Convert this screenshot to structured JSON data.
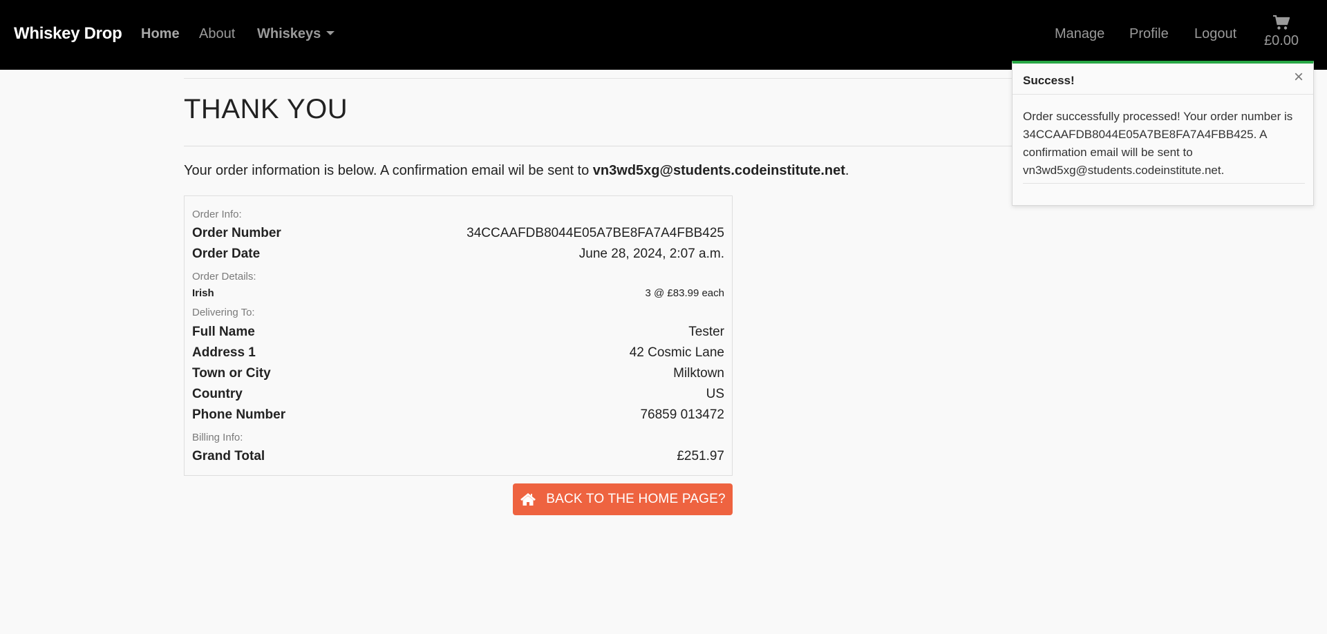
{
  "navbar": {
    "brand": "Whiskey Drop",
    "home": "Home",
    "about": "About",
    "whiskeys": "Whiskeys",
    "manage": "Manage",
    "profile": "Profile",
    "logout": "Logout",
    "cart_total": "£0.00",
    "cart_icon": "shopping-cart-icon"
  },
  "page": {
    "title": "THANK YOU",
    "intro_prefix": "Your order information is below. A confirmation email wil be sent to ",
    "intro_email": "vn3wd5xg@students.codeinstitute.net",
    "intro_suffix": "."
  },
  "order": {
    "order_info_label": "Order Info:",
    "order_number_label": "Order Number",
    "order_number": "34CCAAFDB8044E05A7BE8FA7A4FBB425",
    "order_date_label": "Order Date",
    "order_date": "June 28, 2024, 2:07 a.m.",
    "order_details_label": "Order Details:",
    "items": [
      {
        "name": "Irish",
        "qty_price": "3 @ £83.99 each"
      }
    ],
    "delivering_label": "Delivering To:",
    "full_name_label": "Full Name",
    "full_name": "Tester",
    "address1_label": "Address 1",
    "address1": "42 Cosmic Lane",
    "town_label": "Town or City",
    "town": "Milktown",
    "country_label": "Country",
    "country": "US",
    "phone_label": "Phone Number",
    "phone": "76859 013472",
    "billing_label": "Billing Info:",
    "grand_total_label": "Grand Total",
    "grand_total": "£251.97"
  },
  "back_button": {
    "label": "BACK TO THE HOME PAGE?",
    "icon": "home-icon"
  },
  "toast": {
    "title": "Success!",
    "close": "×",
    "message": "Order successfully processed! Your order number is 34CCAAFDB8044E05A7BE8FA7A4FBB425. A confirmation email will be sent to vn3wd5xg@students.codeinstitute.net.",
    "accent_color": "#28a745"
  },
  "colors": {
    "navbar_bg": "#000000",
    "button_bg": "#ee6340",
    "page_bg": "#f9f9f9"
  }
}
